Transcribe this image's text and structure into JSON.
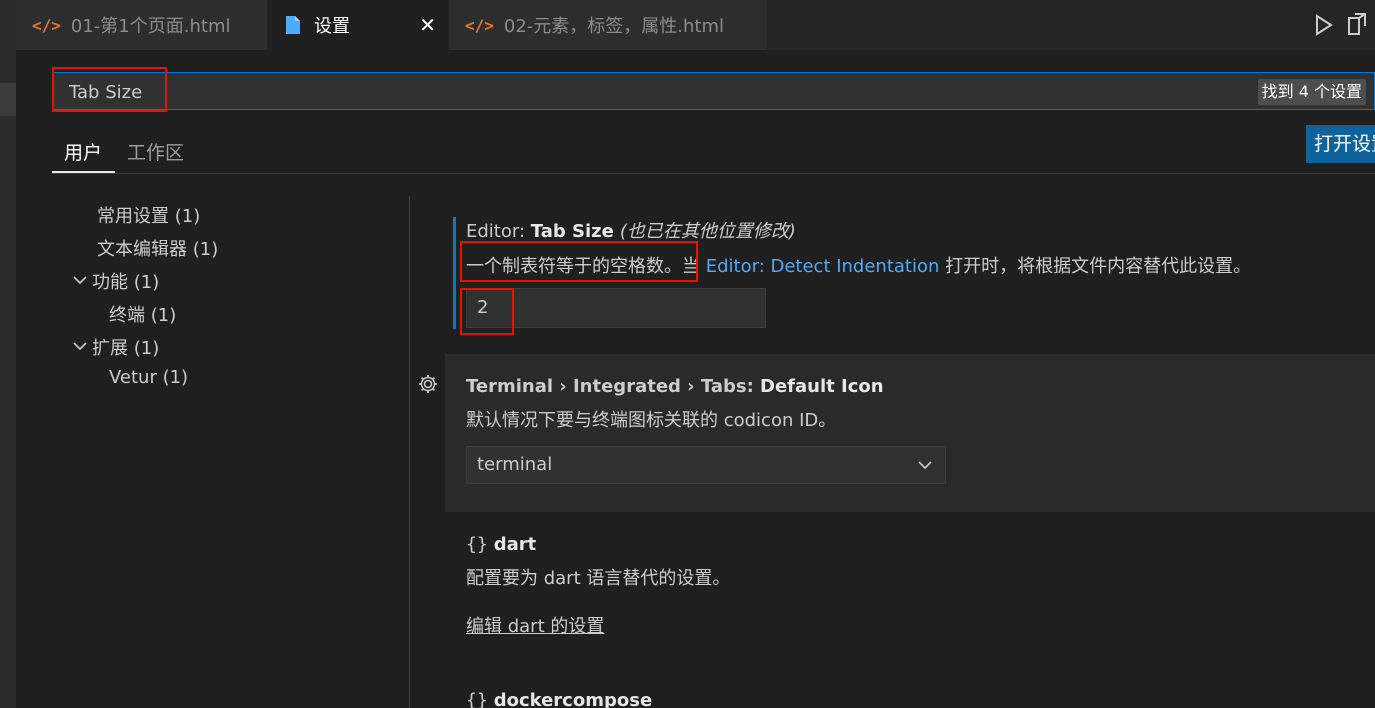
{
  "tabs": [
    {
      "icon": "</>",
      "label": "01-第1个页面.html"
    },
    {
      "label": "设置",
      "close": "✕"
    },
    {
      "icon": "</>",
      "label": "02-元素，标签，属性.html"
    }
  ],
  "search": {
    "value": "Tab Size",
    "found": "找到 4 个设置"
  },
  "scope": {
    "user": "用户",
    "workspace": "工作区",
    "open_json": "打开设置"
  },
  "toc": [
    {
      "label": "常用设置 (1)"
    },
    {
      "label": "文本编辑器 (1)"
    },
    {
      "label": "功能 (1)"
    },
    {
      "label": "终端 (1)"
    },
    {
      "label": "扩展 (1)"
    },
    {
      "label": "Vetur (1)"
    }
  ],
  "settings": {
    "tab_size": {
      "category": "Editor: ",
      "name": "Tab Size",
      "modified": "(也已在其他位置修改)",
      "desc_before": "一个制表符等于的空格数。当 ",
      "desc_link": "Editor: Detect Indentation",
      "desc_after": " 打开时，将根据文件内容替代此设置。",
      "value": "2"
    },
    "terminal_icon": {
      "category": "Terminal › Integrated › Tabs: ",
      "name": "Default Icon",
      "desc": "默认情况下要与终端图标关联的 codicon ID。",
      "value": "terminal"
    },
    "dart": {
      "brace": "{}",
      "name": "dart",
      "desc": "配置要为 dart 语言替代的设置。",
      "edit": "编辑 dart 的设置"
    },
    "dockercompose": {
      "brace": "{}",
      "name": "dockercompose"
    }
  }
}
